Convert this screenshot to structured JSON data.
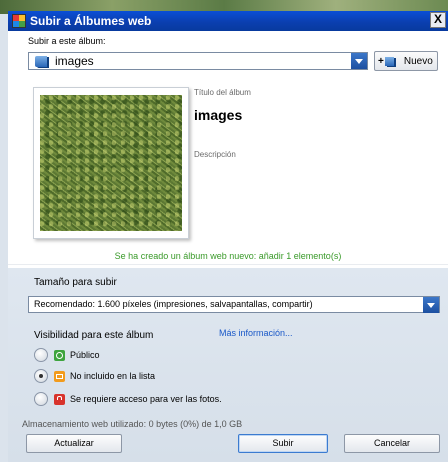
{
  "window": {
    "title": "Subir a Álbumes web",
    "close_label": "X"
  },
  "album": {
    "label": "Subir a este álbum:",
    "selected": "images",
    "new_plus": "+",
    "new_label": "Nuevo",
    "title_label": "Título del álbum",
    "title_value": "images",
    "description_label": "Descripción"
  },
  "status_message": "Se ha creado un álbum web nuevo: añadir 1 elemento(s)",
  "upload_size": {
    "label": "Tamaño para subir",
    "selected": "Recomendado: 1.600 píxeles (impresiones, salvapantallas, compartir)"
  },
  "visibility": {
    "label": "Visibilidad para este álbum",
    "more_info": "Más información...",
    "options": [
      {
        "label": "Público",
        "icon": "globe-icon",
        "color": "#3ea43e",
        "checked": false
      },
      {
        "label": "No incluido en la lista",
        "icon": "unlisted-icon",
        "color": "#f29b1c",
        "checked": true
      },
      {
        "label": "Se requiere acceso para ver las fotos.",
        "icon": "lock-icon",
        "color": "#d8332c",
        "checked": false
      }
    ]
  },
  "storage": "Almacenamiento web utilizado: 0 bytes (0%) de 1,0 GB",
  "buttons": {
    "refresh": "Actualizar",
    "upload": "Subir",
    "cancel": "Cancelar"
  },
  "colors": {
    "titlebar": "#0b3fb0",
    "accent": "#1c4fa0",
    "link": "#1a58c8",
    "status_text": "#3a9a2a"
  }
}
